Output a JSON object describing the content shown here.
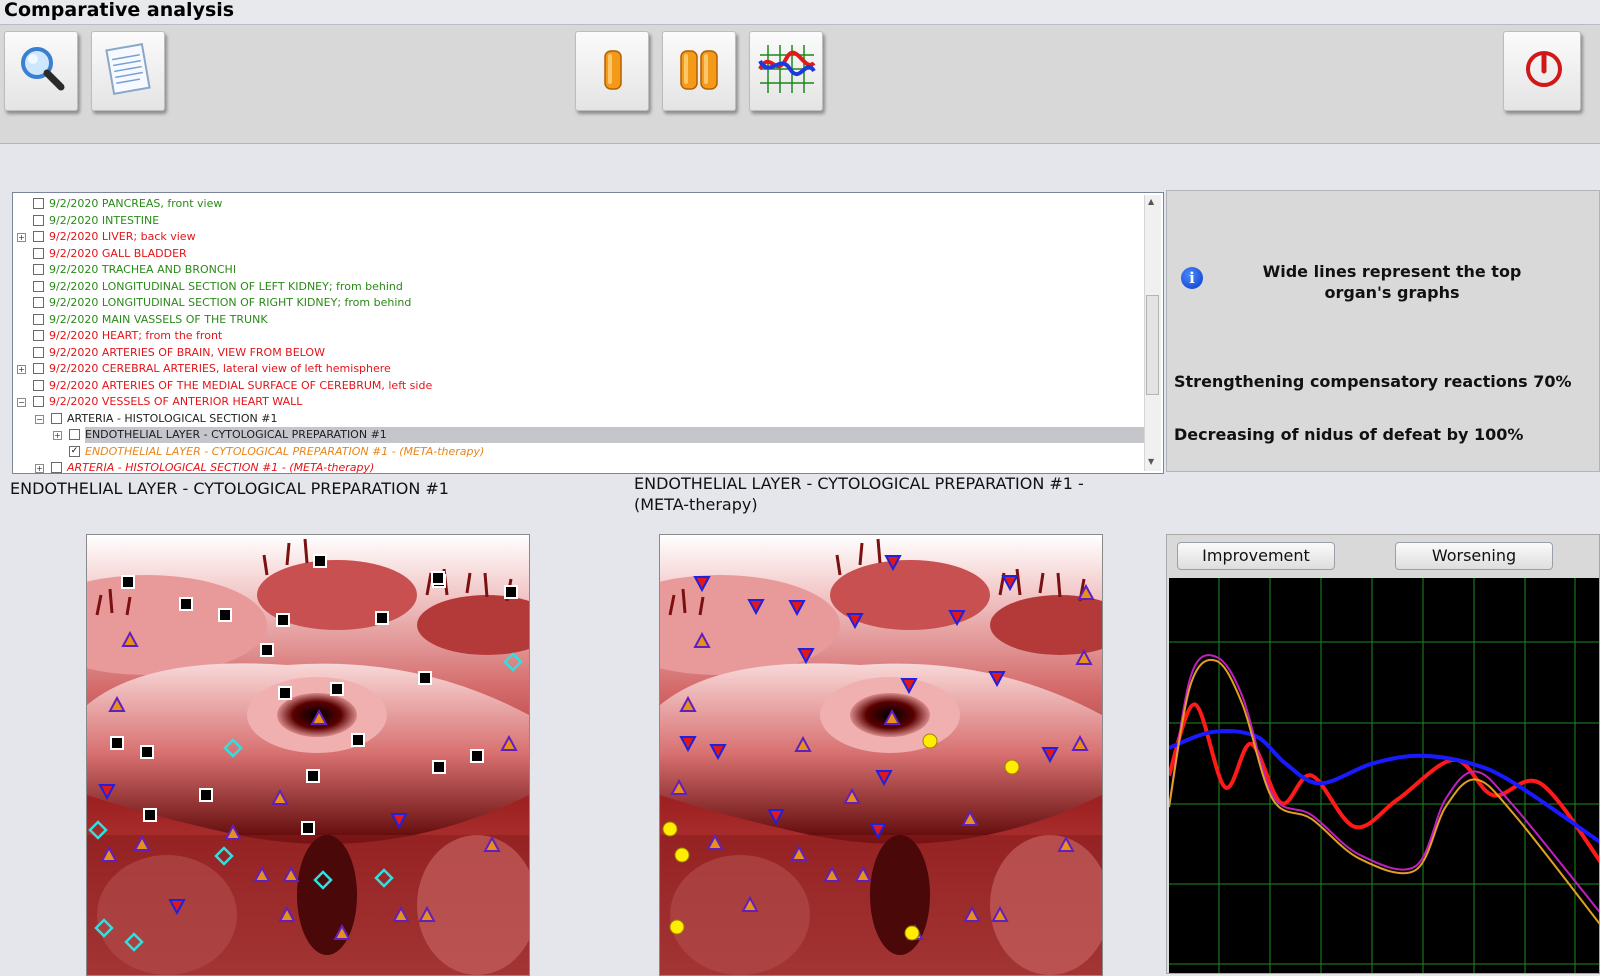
{
  "window": {
    "title": "Comparative analysis"
  },
  "toolbar": {
    "buttons": [
      {
        "name": "search-button",
        "icon": "magnifier-icon"
      },
      {
        "name": "report-button",
        "icon": "notepad-icon"
      },
      {
        "name": "single-view-button",
        "icon": "single-capsule-icon"
      },
      {
        "name": "dual-view-button",
        "icon": "double-capsule-icon"
      },
      {
        "name": "graph-button",
        "icon": "graph-icon"
      },
      {
        "name": "power-button",
        "icon": "power-icon"
      }
    ]
  },
  "tree": {
    "rows": [
      {
        "expander": "",
        "checked": false,
        "level": 0,
        "color": "green",
        "date": "9/2/2020",
        "text": "PANCREAS,  front  view"
      },
      {
        "expander": "",
        "checked": false,
        "level": 0,
        "color": "green",
        "date": "9/2/2020",
        "text": "INTESTINE"
      },
      {
        "expander": "+",
        "checked": false,
        "level": 0,
        "color": "red",
        "date": "9/2/2020",
        "text": "LIVER;  back view"
      },
      {
        "expander": "",
        "checked": false,
        "level": 0,
        "color": "red",
        "date": "9/2/2020",
        "text": "GALL  BLADDER"
      },
      {
        "expander": "",
        "checked": false,
        "level": 0,
        "color": "green",
        "date": "9/2/2020",
        "text": "TRACHEA  AND  BRONCHI"
      },
      {
        "expander": "",
        "checked": false,
        "level": 0,
        "color": "green",
        "date": "9/2/2020",
        "text": "LONGITUDINAL  SECTION  OF  LEFT  KIDNEY;  from behind"
      },
      {
        "expander": "",
        "checked": false,
        "level": 0,
        "color": "green",
        "date": "9/2/2020",
        "text": "LONGITUDINAL  SECTION  OF  RIGHT  KIDNEY;  from behind"
      },
      {
        "expander": "",
        "checked": false,
        "level": 0,
        "color": "green",
        "date": "9/2/2020",
        "text": "MAIN  VASSELS  OF  THE  TRUNK"
      },
      {
        "expander": "",
        "checked": false,
        "level": 0,
        "color": "red",
        "date": "9/2/2020",
        "text": "HEART;  from the front"
      },
      {
        "expander": "",
        "checked": false,
        "level": 0,
        "color": "red",
        "date": "9/2/2020",
        "text": "ARTERIES OF BRAIN, VIEW FROM BELOW"
      },
      {
        "expander": "+",
        "checked": false,
        "level": 0,
        "color": "red",
        "date": "9/2/2020",
        "text": "CEREBRAL ARTERIES, lateral view of left hemisphere"
      },
      {
        "expander": "",
        "checked": false,
        "level": 0,
        "color": "red",
        "date": "9/2/2020",
        "text": "ARTERIES OF THE MEDIAL SURFACE OF CEREBRUM, left side"
      },
      {
        "expander": "-",
        "checked": false,
        "level": 0,
        "color": "red",
        "date": "9/2/2020",
        "text": "VESSELS OF ANTERIOR HEART  WALL"
      },
      {
        "expander": "-",
        "checked": false,
        "level": 1,
        "color": "black",
        "date": "",
        "text": "ARTERIA - HISTOLOGICAL SECTION #1"
      },
      {
        "expander": "+",
        "checked": false,
        "level": 2,
        "color": "black",
        "date": "",
        "text": "ENDOTHELIAL LAYER - CYTOLOGICAL PREPARATION #1",
        "selected": true
      },
      {
        "expander": "",
        "checked": true,
        "level": 2,
        "color": "orange",
        "date": "",
        "text": "ENDOTHELIAL LAYER - CYTOLOGICAL PREPARATION #1 - (META-therapy)"
      },
      {
        "expander": "+",
        "checked": false,
        "level": 1,
        "color": "red-italic",
        "date": "",
        "text": "ARTERIA - HISTOLOGICAL SECTION #1 - (META-therapy)"
      }
    ]
  },
  "info_panel": {
    "icon": "info-icon",
    "note": "Wide lines represent the top organ's graphs",
    "line1": "Strengthening compensatory reactions 70%",
    "line2": "Decreasing of nidus of defeat by 100%"
  },
  "captions": {
    "left": "ENDOTHELIAL LAYER - CYTOLOGICAL PREPARATION #1",
    "right": "ENDOTHELIAL LAYER - CYTOLOGICAL PREPARATION #1 - (META-therapy)"
  },
  "chart_panel": {
    "improvement_label": "Improvement",
    "worsening_label": "Worsening"
  },
  "chart_data": {
    "type": "line",
    "grid": true,
    "background": "#000000",
    "grid_color": "#1e8a1e",
    "series": [
      {
        "color": "#ff1a1a",
        "width": 4,
        "values": [
          [
            0,
            0.5
          ],
          [
            0.06,
            0.32
          ],
          [
            0.13,
            0.53
          ],
          [
            0.19,
            0.42
          ],
          [
            0.26,
            0.57
          ],
          [
            0.33,
            0.5
          ],
          [
            0.43,
            0.63
          ],
          [
            0.53,
            0.56
          ],
          [
            0.66,
            0.46
          ],
          [
            0.75,
            0.55
          ],
          [
            0.86,
            0.52
          ],
          [
            1,
            0.72
          ]
        ]
      },
      {
        "color": "#1a1aff",
        "width": 4,
        "values": [
          [
            0,
            0.43
          ],
          [
            0.1,
            0.39
          ],
          [
            0.2,
            0.4
          ],
          [
            0.27,
            0.47
          ],
          [
            0.35,
            0.52
          ],
          [
            0.47,
            0.47
          ],
          [
            0.58,
            0.45
          ],
          [
            0.7,
            0.47
          ],
          [
            0.8,
            0.52
          ],
          [
            1,
            0.67
          ]
        ]
      },
      {
        "color": "#c020c0",
        "width": 2,
        "values": [
          [
            0,
            0.58
          ],
          [
            0.05,
            0.25
          ],
          [
            0.11,
            0.2
          ],
          [
            0.17,
            0.3
          ],
          [
            0.24,
            0.55
          ],
          [
            0.33,
            0.6
          ],
          [
            0.44,
            0.7
          ],
          [
            0.57,
            0.73
          ],
          [
            0.64,
            0.56
          ],
          [
            0.71,
            0.49
          ],
          [
            0.8,
            0.58
          ],
          [
            1,
            0.85
          ]
        ]
      },
      {
        "color": "#e0a020",
        "width": 2,
        "values": [
          [
            0,
            0.58
          ],
          [
            0.05,
            0.27
          ],
          [
            0.11,
            0.21
          ],
          [
            0.17,
            0.32
          ],
          [
            0.24,
            0.56
          ],
          [
            0.33,
            0.61
          ],
          [
            0.44,
            0.71
          ],
          [
            0.57,
            0.74
          ],
          [
            0.64,
            0.58
          ],
          [
            0.71,
            0.51
          ],
          [
            0.8,
            0.6
          ],
          [
            1,
            0.88
          ]
        ]
      }
    ]
  }
}
